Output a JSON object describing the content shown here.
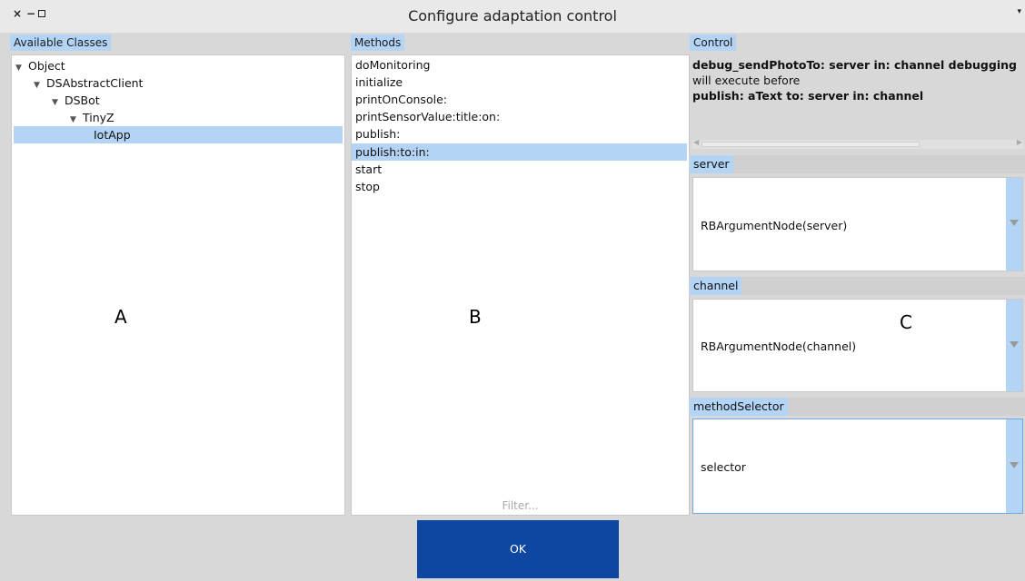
{
  "window": {
    "title": "Configure adaptation control",
    "close_glyph": "×",
    "minimize_glyph": "−",
    "menu_glyph": "▾"
  },
  "classes": {
    "label": "Available Classes",
    "tree": [
      {
        "label": "Object",
        "expanded": true,
        "level": 0,
        "selected": false
      },
      {
        "label": "DSAbstractClient",
        "expanded": true,
        "level": 1,
        "selected": false
      },
      {
        "label": "DSBot",
        "expanded": true,
        "level": 2,
        "selected": false
      },
      {
        "label": "TinyZ",
        "expanded": true,
        "level": 3,
        "selected": false
      },
      {
        "label": "IotApp",
        "expanded": false,
        "level": 4,
        "selected": true
      }
    ],
    "overlay_letter": "A"
  },
  "methods": {
    "label": "Methods",
    "items": [
      "doMonitoring",
      "initialize",
      "printOnConsole:",
      "printSensorValue:title:on:",
      "publish:",
      "publish:to:in:",
      "start",
      "stop"
    ],
    "selected_index": 5,
    "filter_placeholder": "Filter...",
    "overlay_letter": "B"
  },
  "control": {
    "label": "Control",
    "line1": "debug_sendPhotoTo: server in: channel debugging",
    "line2": "will execute before",
    "line3": "publish: aText to: server in: channel",
    "overlay_letter": "C",
    "sections": [
      {
        "label": "server",
        "value": "RBArgumentNode(server)"
      },
      {
        "label": "channel",
        "value": "RBArgumentNode(channel)"
      },
      {
        "label": "methodSelector",
        "value": "selector"
      }
    ]
  },
  "ok_label": "OK",
  "colors": {
    "selection": "#b3d4f5",
    "ok_button": "#0e47a1"
  }
}
